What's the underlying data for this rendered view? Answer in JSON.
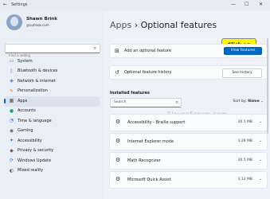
{
  "window": {
    "title": "Settings",
    "controls": {
      "minimize": "—",
      "maximize": "☐",
      "close": "✕"
    }
  },
  "user": {
    "name": "Shawn Brink",
    "email": "@outlook.com"
  },
  "sidebar": {
    "search_placeholder": "Find a setting",
    "items": [
      {
        "label": "System",
        "icon": "monitor-icon",
        "color": "#2b7bd6"
      },
      {
        "label": "Bluetooth & devices",
        "icon": "bluetooth-icon",
        "color": "#2b7bd6"
      },
      {
        "label": "Network & internet",
        "icon": "wifi-icon",
        "color": "#2b7bd6"
      },
      {
        "label": "Personalization",
        "icon": "brush-icon",
        "color": "#e0712e"
      },
      {
        "label": "Apps",
        "icon": "apps-icon",
        "color": "#555555",
        "active": true
      },
      {
        "label": "Accounts",
        "icon": "person-icon",
        "color": "#2aa36b"
      },
      {
        "label": "Time & language",
        "icon": "globe-clock-icon",
        "color": "#2b7bd6"
      },
      {
        "label": "Gaming",
        "icon": "controller-icon",
        "color": "#666666"
      },
      {
        "label": "Accessibility",
        "icon": "accessibility-icon",
        "color": "#2b7bd6"
      },
      {
        "label": "Privacy & security",
        "icon": "shield-icon",
        "color": "#666666"
      },
      {
        "label": "Windows Update",
        "icon": "update-icon",
        "color": "#2b7bd6"
      },
      {
        "label": "Mixed reality",
        "icon": "headset-icon",
        "color": "#666666"
      }
    ]
  },
  "main": {
    "breadcrumb_parent": "Apps",
    "breadcrumb_sep": "›",
    "breadcrumb_current": "Optional features",
    "add_feature_label": "Add an optional feature",
    "view_features_button": "View features",
    "history_label": "Optional feature history",
    "see_history_button": "See history",
    "callout": "Click on",
    "installed_heading": "Installed features",
    "installed_search_placeholder": "Search",
    "sort_by_label": "Sort by:",
    "sort_by_value": "Name",
    "watermark": "ElevenForum.com",
    "features": [
      {
        "name": "Accessibility - Braille support",
        "size": "30.1 MB"
      },
      {
        "name": "Internet Explorer mode",
        "size": "3.28 MB"
      },
      {
        "name": "Math Recognizer",
        "size": "30.5 MB"
      },
      {
        "name": "Microsoft Quick Assist",
        "size": "3.12 MB"
      }
    ]
  },
  "colors": {
    "accent": "#0067c0",
    "callout": "#fff700"
  }
}
